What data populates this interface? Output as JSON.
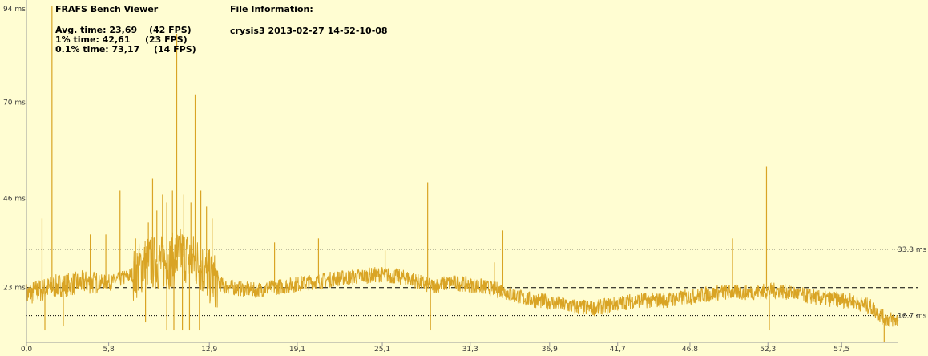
{
  "viewer": {
    "title": "FRAFS Bench Viewer",
    "file_info_label": "File Information:",
    "file_name": "crysis3 2013-02-27 14-52-10-08",
    "stats": [
      {
        "label": "Avg. time: 23,69",
        "fps": "(42 FPS)"
      },
      {
        "label": "1% time: 42,61",
        "fps": "(23 FPS)"
      },
      {
        "label": "0.1% time: 73,17",
        "fps": "(14 FPS)"
      }
    ]
  },
  "colors": {
    "background": "#fffdd2",
    "series": "#d9a424",
    "reference_lines": "#000000",
    "axis": "#9a9a9a"
  },
  "chart_data": {
    "type": "line",
    "title": "",
    "xlabel": "",
    "ylabel": "",
    "xlim": [
      0,
      61.5
    ],
    "ylim": [
      10,
      94
    ],
    "y_ticks": [
      {
        "value": 94,
        "label": "94 ms"
      },
      {
        "value": 70,
        "label": "70 ms"
      },
      {
        "value": 46,
        "label": "46 ms"
      },
      {
        "value": 23.69,
        "label": "23 ms"
      }
    ],
    "x_ticks": [
      "0,0",
      "5,8",
      "12,9",
      "19,1",
      "25,1",
      "31,3",
      "36,9",
      "41,7",
      "46,8",
      "52,3",
      "57,5"
    ],
    "x_tick_values": [
      0,
      5.8,
      12.9,
      19.1,
      25.1,
      31.3,
      36.9,
      41.7,
      46.8,
      52.3,
      57.5
    ],
    "reference_lines": [
      {
        "value": 33.3,
        "label": "33.3 ms",
        "style": "dotted"
      },
      {
        "value": 23.69,
        "label": "",
        "style": "dashed"
      },
      {
        "value": 16.7,
        "label": "16.7 ms",
        "style": "dotted"
      }
    ],
    "series": [
      {
        "name": "",
        "baseline": [
          [
            0,
            22
          ],
          [
            2,
            24
          ],
          [
            4,
            25
          ],
          [
            6,
            25
          ],
          [
            7.5,
            27
          ],
          [
            8.5,
            30
          ],
          [
            10,
            30
          ],
          [
            11,
            32
          ],
          [
            12,
            30
          ],
          [
            13,
            26
          ],
          [
            14,
            24
          ],
          [
            16,
            23
          ],
          [
            18,
            24
          ],
          [
            20,
            25
          ],
          [
            22,
            26
          ],
          [
            25,
            27
          ],
          [
            27,
            26
          ],
          [
            28.5,
            24
          ],
          [
            30,
            25
          ],
          [
            32,
            24
          ],
          [
            33.5,
            23
          ],
          [
            35,
            21
          ],
          [
            37,
            20
          ],
          [
            38.5,
            19
          ],
          [
            40,
            18.5
          ],
          [
            41.5,
            19.5
          ],
          [
            43,
            20.5
          ],
          [
            45,
            20.5
          ],
          [
            47,
            21.5
          ],
          [
            49,
            22.5
          ],
          [
            51,
            22.5
          ],
          [
            53,
            23
          ],
          [
            54.5,
            22
          ],
          [
            56,
            21
          ],
          [
            58,
            20.5
          ],
          [
            59.5,
            19
          ],
          [
            60.5,
            16
          ],
          [
            61.5,
            15.5
          ]
        ],
        "spikes": [
          {
            "x": 1.1,
            "y": 41
          },
          {
            "x": 1.8,
            "y": 94
          },
          {
            "x": 4.5,
            "y": 37
          },
          {
            "x": 5.6,
            "y": 37
          },
          {
            "x": 6.6,
            "y": 48
          },
          {
            "x": 7.7,
            "y": 36
          },
          {
            "x": 8.6,
            "y": 40
          },
          {
            "x": 8.9,
            "y": 51
          },
          {
            "x": 9.2,
            "y": 43
          },
          {
            "x": 9.6,
            "y": 47
          },
          {
            "x": 9.9,
            "y": 45
          },
          {
            "x": 10.3,
            "y": 48
          },
          {
            "x": 10.6,
            "y": 87
          },
          {
            "x": 11.1,
            "y": 47
          },
          {
            "x": 11.6,
            "y": 45
          },
          {
            "x": 11.9,
            "y": 72
          },
          {
            "x": 12.3,
            "y": 48
          },
          {
            "x": 12.7,
            "y": 44
          },
          {
            "x": 13.1,
            "y": 41
          },
          {
            "x": 17.5,
            "y": 35
          },
          {
            "x": 20.6,
            "y": 36
          },
          {
            "x": 25.3,
            "y": 33
          },
          {
            "x": 28.3,
            "y": 50
          },
          {
            "x": 33.0,
            "y": 30
          },
          {
            "x": 33.6,
            "y": 38
          },
          {
            "x": 49.8,
            "y": 36
          },
          {
            "x": 52.2,
            "y": 54
          }
        ],
        "dips": [
          {
            "x": 1.3,
            "y": 13
          },
          {
            "x": 2.6,
            "y": 14
          },
          {
            "x": 8.4,
            "y": 15
          },
          {
            "x": 9.9,
            "y": 13
          },
          {
            "x": 10.4,
            "y": 13
          },
          {
            "x": 11.0,
            "y": 13
          },
          {
            "x": 11.5,
            "y": 13
          },
          {
            "x": 12.2,
            "y": 13
          },
          {
            "x": 28.5,
            "y": 13
          },
          {
            "x": 52.4,
            "y": 13
          },
          {
            "x": 60.5,
            "y": 10
          }
        ]
      }
    ]
  }
}
